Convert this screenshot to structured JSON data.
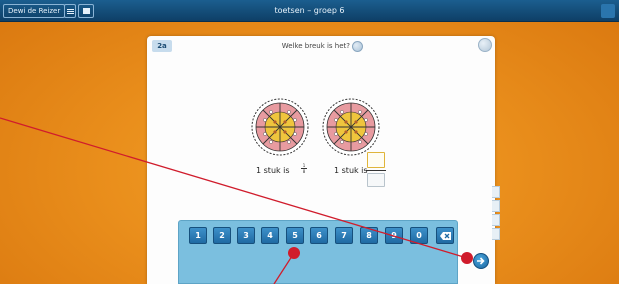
{
  "topbar": {
    "user_label": "Dewi de Reizer",
    "title": "toetsen – groep 6"
  },
  "exercise": {
    "number": "2a",
    "question": "Welke breuk is het?",
    "caption_left": "1 stuk is",
    "fraction_left_num": "1",
    "fraction_left_den": "8",
    "caption_right": "1 stuk is"
  },
  "keypad": {
    "keys": [
      "1",
      "2",
      "3",
      "4",
      "5",
      "6",
      "7",
      "8",
      "9",
      "0"
    ]
  },
  "colors": {
    "background": "#ea8f1c",
    "topbar": "#0e3f66",
    "keypad": "#7bbfdf",
    "key": "#1f6aa3",
    "annotation": "#d01c2c"
  },
  "icons": {
    "menu": "hamburger-icon",
    "screen": "screen-icon",
    "audio": "speaker-icon",
    "backspace": "backspace-icon",
    "next": "arrow-right-icon"
  }
}
